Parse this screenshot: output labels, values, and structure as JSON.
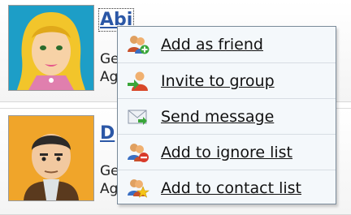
{
  "users": [
    {
      "name": "Abi",
      "info_line1": "Ge",
      "info_line2": "Ag"
    },
    {
      "name": "D",
      "info_line1": "Ge",
      "info_line2": "Ag"
    }
  ],
  "context_menu": {
    "items": [
      {
        "label": "Add as friend",
        "icon": "add-friend-icon"
      },
      {
        "label": "Invite to group",
        "icon": "invite-group-icon"
      },
      {
        "label": "Send message",
        "icon": "envelope-icon"
      },
      {
        "label": "Add to ignore list",
        "icon": "ignore-icon"
      },
      {
        "label": "Add to contact list",
        "icon": "contact-star-icon"
      }
    ]
  }
}
